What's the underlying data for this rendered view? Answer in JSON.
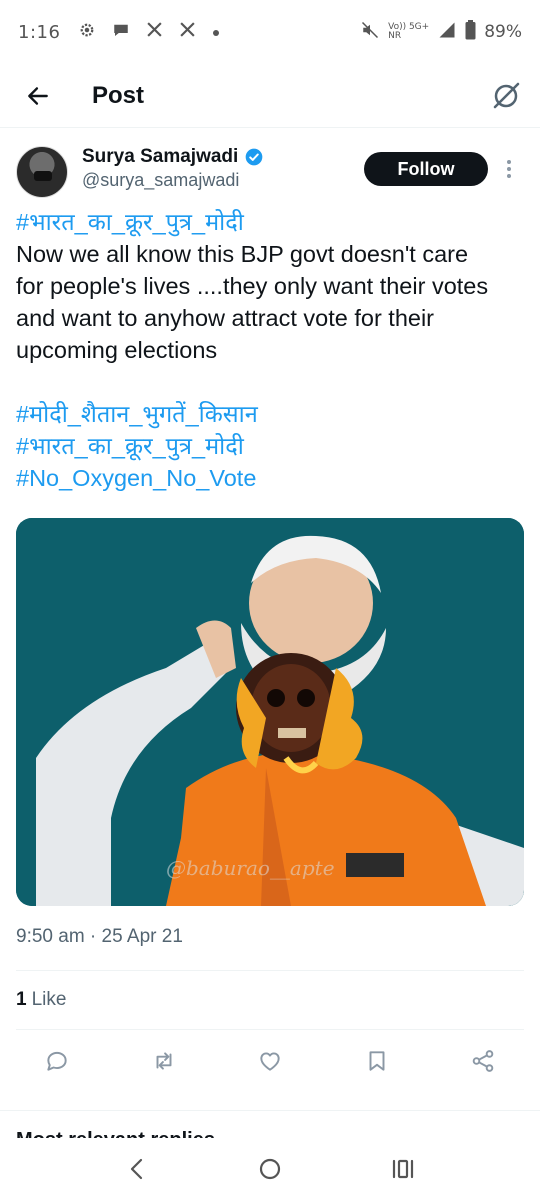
{
  "status": {
    "time": "1:16",
    "network_top": "Vo)) 5G+",
    "network_bottom": "NR",
    "battery": "89%"
  },
  "header": {
    "title": "Post"
  },
  "post": {
    "author": {
      "display_name": "Surya Samajwadi",
      "handle": "@surya_samajwadi",
      "verified": true
    },
    "follow_label": "Follow",
    "hashtag_top": "#भारत_का_क्रूर_पुत्र_मोदी",
    "body_lines": [
      "Now we all know this BJP govt doesn't care",
      "for people's lives ....they only want their votes",
      "and want to anyhow attract vote for their",
      "upcoming elections"
    ],
    "hashtags": [
      "#मोदी_शैतान_भुगतें_किसान",
      "#भारत_का_क्रूर_पुत्र_मोदी",
      "#No_Oxygen_No_Vote"
    ],
    "media_watermark": "@baburao__apte",
    "timestamp": "9:50 am · 25 Apr 21",
    "likes_count": "1",
    "likes_label": "Like"
  },
  "replies_heading": "Most relevant replies",
  "colors": {
    "accent": "#1d9bf0",
    "text": "#0f1419",
    "secondary": "#536471",
    "media_bg": "#0d5f6b",
    "vest": "#f07a1a"
  },
  "icons": {
    "status_left": [
      "gear-icon",
      "chat-bubble-icon",
      "x-logo-icon",
      "x-logo-icon",
      "dot-icon"
    ],
    "status_right": [
      "mute-icon",
      "signal-icon",
      "battery-icon"
    ],
    "actions": [
      "reply-icon",
      "repost-icon",
      "like-icon",
      "bookmark-icon",
      "share-icon"
    ],
    "nav": [
      "back-chevron-icon",
      "home-circle-icon",
      "recents-icon"
    ]
  }
}
